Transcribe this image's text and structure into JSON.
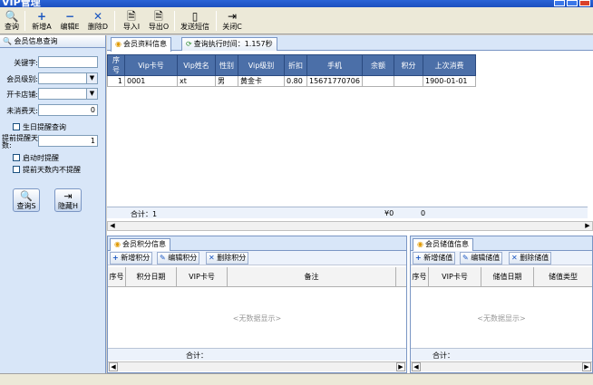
{
  "window": {
    "title": "VIP管理"
  },
  "toolbar": {
    "query": "查询",
    "add": "新增A",
    "edit": "编辑E",
    "delete": "删除D",
    "import": "导入I",
    "export": "导出O",
    "sms": "发送短信",
    "close": "关闭C"
  },
  "left": {
    "tab": "会员信息查询",
    "keyword_label": "关键字:",
    "keyword_value": "",
    "level_label": "会员级别:",
    "level_value": "",
    "store_label": "开卡店铺:",
    "store_value": "",
    "days_label": "未消费天:",
    "days_value": "0",
    "birthday_check": "生日提醒查询",
    "remind_label": "提前提醒天数:",
    "remind_value": "1",
    "start_remind": "启动时提醒",
    "no_remind": "提前天数内不提醒",
    "query_btn": "查询S",
    "hide_btn": "隐藏H"
  },
  "main": {
    "tab1": "会员资料信息",
    "tab2": "查询执行时间：1.157秒",
    "columns": [
      "序号",
      "Vip卡号",
      "Vip姓名",
      "性别",
      "Vip级别",
      "折扣",
      "手机",
      "余额",
      "积分",
      "上次消费"
    ],
    "rows": [
      [
        "1",
        "0001",
        "xt",
        "男",
        "黄金卡",
        "0.80",
        "15671770706",
        "",
        "",
        "1900-01-01"
      ]
    ],
    "total_label": "合计：1",
    "total_balance": "¥0",
    "total_points": "0"
  },
  "points": {
    "tab": "会员积分信息",
    "add": "新增积分",
    "edit": "编辑积分",
    "delete": "删除积分",
    "columns": [
      "序号",
      "积分日期",
      "VIP卡号",
      "备注"
    ],
    "empty": "<无数据显示>",
    "total": "合计："
  },
  "stored": {
    "tab": "会员储值信息",
    "add": "新增储值",
    "edit": "编辑储值",
    "delete": "删除储值",
    "columns": [
      "序号",
      "VIP卡号",
      "储值日期",
      "储值类型"
    ],
    "empty": "<无数据显示>",
    "total": "合计："
  }
}
